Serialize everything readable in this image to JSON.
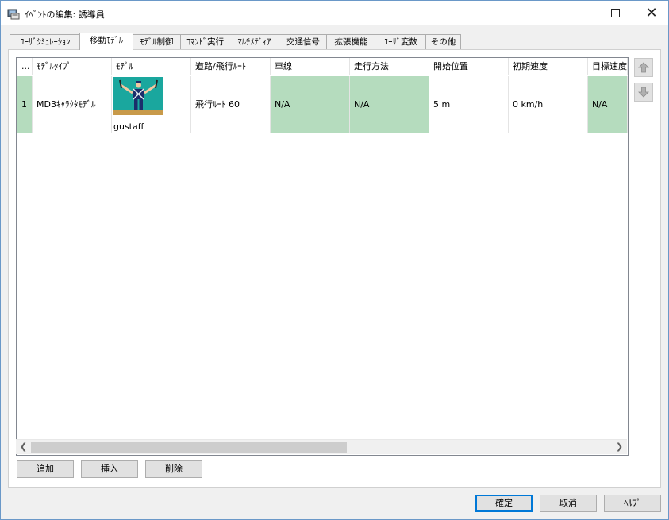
{
  "window": {
    "title": "ｲﾍﾞﾝﾄの編集: 誘導員",
    "icon": "event-edit-icon",
    "controls": [
      "minimize-icon",
      "maximize-icon",
      "close-icon"
    ]
  },
  "tabs": [
    {
      "label": "ﾕｰｻﾞｼﾐｭﾚｰｼｮﾝ"
    },
    {
      "label": "移動ﾓﾃﾞﾙ",
      "active": true
    },
    {
      "label": "ﾓﾃﾞﾙ制御"
    },
    {
      "label": "ｺﾏﾝﾄﾞ実行"
    },
    {
      "label": "ﾏﾙﾁﾒﾃﾞｨｱ"
    },
    {
      "label": "交通信号"
    },
    {
      "label": "拡張機能"
    },
    {
      "label": "ﾕｰｻﾞ変数"
    },
    {
      "label": "その他"
    }
  ],
  "table": {
    "headers": [
      "...",
      "ﾓﾃﾞﾙﾀｲﾌﾟ",
      "ﾓﾃﾞﾙ",
      "道路/飛行ﾙｰﾄ",
      "車線",
      "走行方法",
      "開始位置",
      "初期速度",
      "目標速度"
    ],
    "rows": [
      {
        "index": "1",
        "model_type": "MD3ｷｬﾗｸﾀﾓﾃﾞﾙ",
        "model_name": "gustaff",
        "route": "飛行ﾙｰﾄ 60",
        "lane": "N/A",
        "travel_method": "N/A",
        "start_position": "5 m",
        "initial_speed": "0 km/h",
        "target_speed": "N/A"
      }
    ],
    "highlight_color": "#b5dcbe"
  },
  "side_buttons": [
    "move-up-icon",
    "move-down-icon"
  ],
  "actions": {
    "add": "追加",
    "insert": "挿入",
    "delete": "削除"
  },
  "footer": {
    "ok": "確定",
    "cancel": "取消",
    "help": "ﾍﾙﾌﾟ"
  }
}
